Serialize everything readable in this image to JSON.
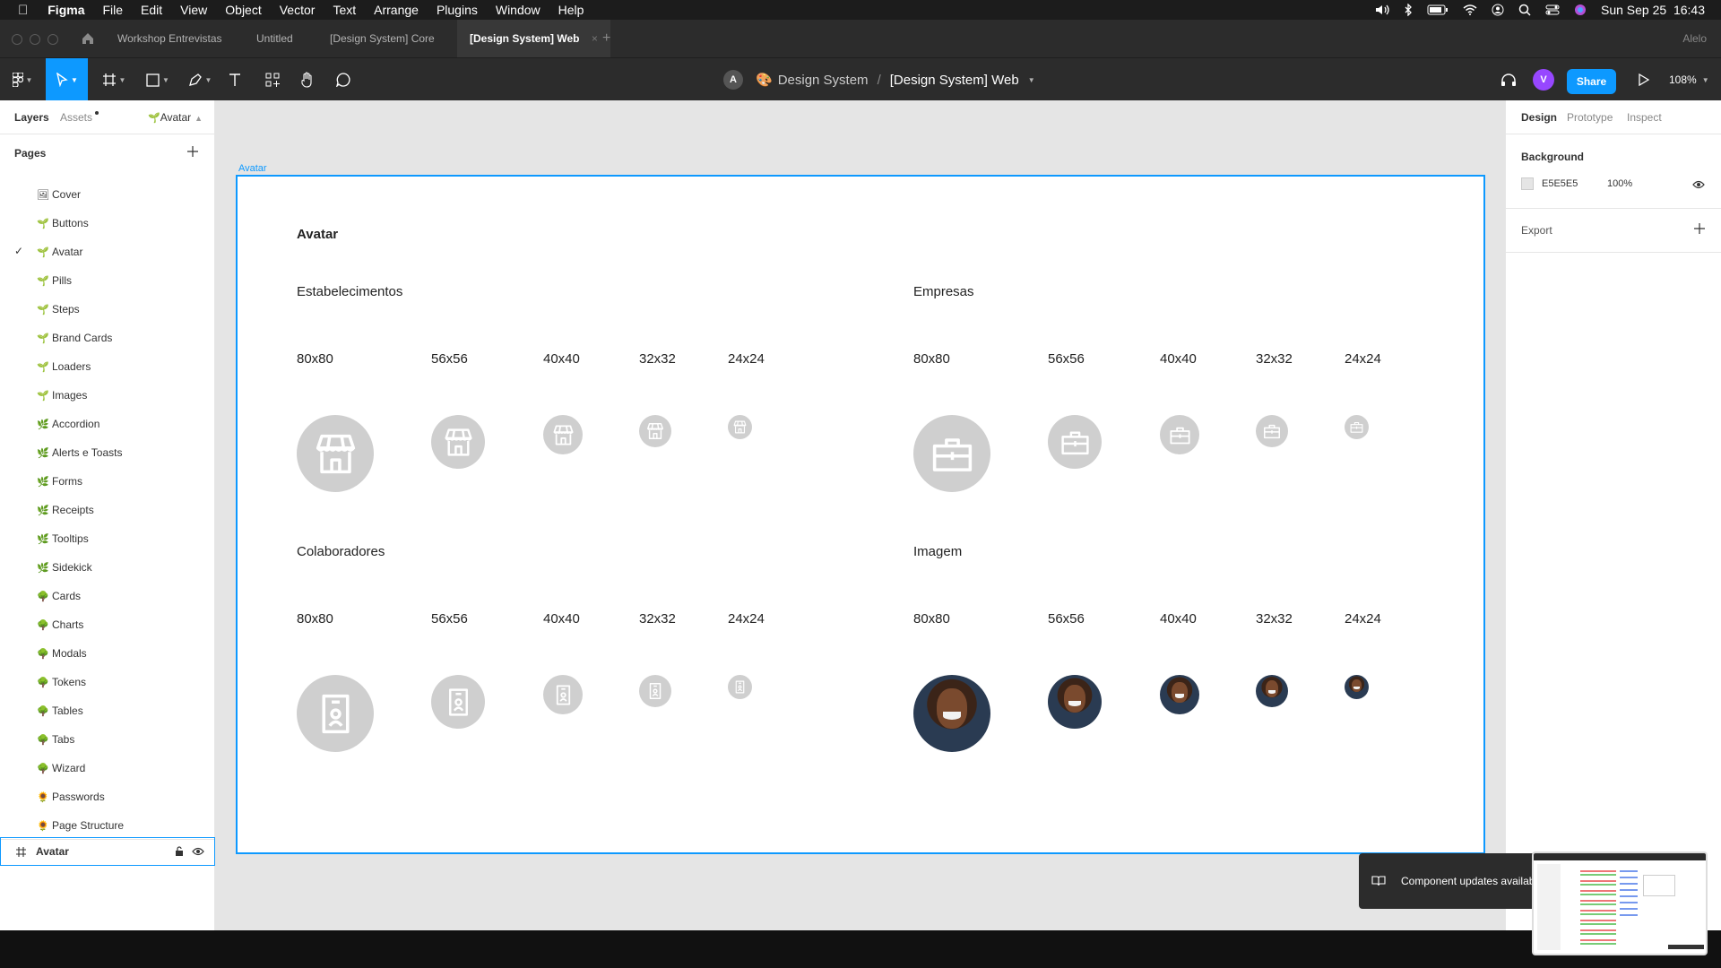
{
  "menubar": {
    "app": "Figma",
    "items": [
      "File",
      "Edit",
      "View",
      "Object",
      "Vector",
      "Text",
      "Arrange",
      "Plugins",
      "Window",
      "Help"
    ],
    "datetime": "Sun Sep 25  16:43"
  },
  "tabs": {
    "items": [
      "Workshop Entrevistas",
      "Untitled",
      "[Design System] Core",
      "[Design System] Web"
    ],
    "user": "Alelo"
  },
  "toolbar": {
    "avatar_letter": "A",
    "breadcrumb_team": "Design System",
    "breadcrumb_sep": "/",
    "file_name": "[Design System] Web",
    "user_initial": "V",
    "share": "Share",
    "zoom": "108%"
  },
  "left_panel": {
    "tab_layers": "Layers",
    "tab_assets": "Assets",
    "current_page": "Avatar",
    "pages_header": "Pages",
    "pages": [
      {
        "emoji": "🖼",
        "label": "Cover"
      },
      {
        "emoji": "🌱",
        "label": "Buttons"
      },
      {
        "emoji": "🌱",
        "label": "Avatar"
      },
      {
        "emoji": "🌱",
        "label": "Pills"
      },
      {
        "emoji": "🌱",
        "label": "Steps"
      },
      {
        "emoji": "🌱",
        "label": "Brand Cards"
      },
      {
        "emoji": "🌱",
        "label": "Loaders"
      },
      {
        "emoji": "🌱",
        "label": "Images"
      },
      {
        "emoji": "🌿",
        "label": "Accordion"
      },
      {
        "emoji": "🌿",
        "label": "Alerts e Toasts"
      },
      {
        "emoji": "🌿",
        "label": "Forms"
      },
      {
        "emoji": "🌿",
        "label": "Receipts"
      },
      {
        "emoji": "🌿",
        "label": "Tooltips"
      },
      {
        "emoji": "🌿",
        "label": "Sidekick"
      },
      {
        "emoji": "🌳",
        "label": "Cards"
      },
      {
        "emoji": "🌳",
        "label": "Charts"
      },
      {
        "emoji": "🌳",
        "label": "Modals"
      },
      {
        "emoji": "🌳",
        "label": "Tokens"
      },
      {
        "emoji": "🌳",
        "label": "Tables"
      },
      {
        "emoji": "🌳",
        "label": "Tabs"
      },
      {
        "emoji": "🌳",
        "label": "Wizard"
      },
      {
        "emoji": "🌻",
        "label": "Passwords"
      },
      {
        "emoji": "🌻",
        "label": "Page Structure"
      }
    ],
    "layer": "Avatar"
  },
  "canvas": {
    "frame_label": "Avatar",
    "title": "Avatar",
    "sections": [
      {
        "title": "Estabelecimentos",
        "icon": "storefront-icon"
      },
      {
        "title": "Empresas",
        "icon": "briefcase-icon"
      },
      {
        "title": "Colaboradores",
        "icon": "badge-icon"
      },
      {
        "title": "Imagem",
        "icon": "photo"
      }
    ],
    "sizes": [
      "80x80",
      "56x56",
      "40x40",
      "32x32",
      "24x24"
    ]
  },
  "right_panel": {
    "tabs": [
      "Design",
      "Prototype",
      "Inspect"
    ],
    "background_label": "Background",
    "bg_hex": "E5E5E5",
    "bg_opacity": "100%",
    "export_label": "Export"
  },
  "toast": "Component updates availab"
}
